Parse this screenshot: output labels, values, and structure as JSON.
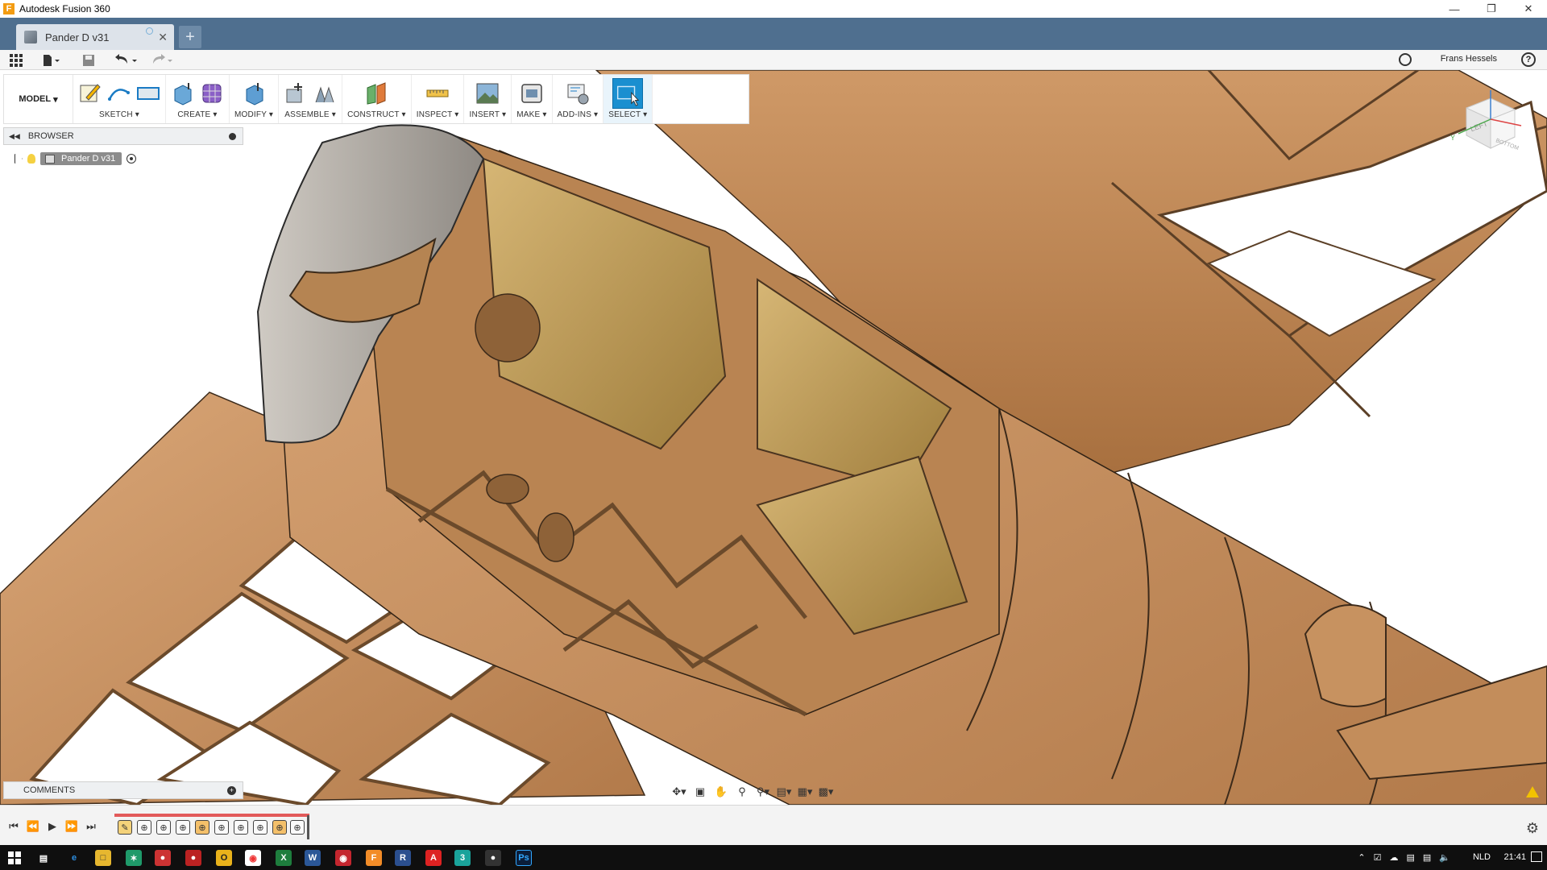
{
  "window": {
    "title": "Autodesk Fusion 360",
    "controls": [
      "minimize",
      "restore",
      "close"
    ]
  },
  "tab": {
    "name": "Pander D v31",
    "new_tab_symbol": "+"
  },
  "quickaccess": {
    "user": "Frans Hessels",
    "help_symbol": "?"
  },
  "toolbar": {
    "workspace": "MODEL",
    "groups": [
      {
        "label": "SKETCH"
      },
      {
        "label": "CREATE"
      },
      {
        "label": "MODIFY"
      },
      {
        "label": "ASSEMBLE"
      },
      {
        "label": "CONSTRUCT"
      },
      {
        "label": "INSPECT"
      },
      {
        "label": "INSERT"
      },
      {
        "label": "MAKE"
      },
      {
        "label": "ADD-INS"
      },
      {
        "label": "SELECT"
      }
    ]
  },
  "browser": {
    "title": "BROWSER",
    "root": "Pander D v31"
  },
  "viewcube": {
    "face": "LEFT",
    "bottom_face": "BOTTOM",
    "axis_y": "Y"
  },
  "comments": {
    "title": "COMMENTS"
  },
  "taskbar": {
    "lang": "NLD",
    "time": "21:41"
  },
  "colors": {
    "tabbar": "#4f6f8f",
    "select_accent": "#1a8fd0",
    "wood": "#c8905e",
    "timeline_track": "#e25a5a",
    "taskbar": "#0f0f0f"
  }
}
